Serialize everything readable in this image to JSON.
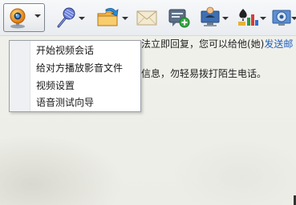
{
  "toolbar": {
    "buttons": [
      {
        "name": "video-chat",
        "icon": "webcam-icon",
        "has_dropdown": true
      },
      {
        "name": "voice-chat",
        "icon": "microphone-icon",
        "has_dropdown": true
      },
      {
        "name": "send-file",
        "icon": "folder-send-icon",
        "has_dropdown": true
      },
      {
        "name": "send-mail",
        "icon": "envelope-icon",
        "has_dropdown": false
      },
      {
        "name": "send-sms",
        "icon": "sms-add-icon",
        "has_dropdown": false
      },
      {
        "name": "remote-assist",
        "icon": "monitor-person-icon",
        "has_dropdown": true
      },
      {
        "name": "apps",
        "icon": "apps-icon",
        "has_dropdown": true
      },
      {
        "name": "settings",
        "icon": "settings-icon",
        "has_dropdown": true
      }
    ]
  },
  "chat": {
    "notice_text": "法立即回复，您可以给他(她)",
    "notice_link": "发送邮",
    "notice_text_2": "信息，勿轻易拨打陌生电话。"
  },
  "dropdown_menu": {
    "items": [
      {
        "label": "开始视频会话"
      },
      {
        "label": "给对方播放影音文件"
      },
      {
        "label": "视频设置"
      },
      {
        "label": "语音测试向导"
      }
    ]
  },
  "colors": {
    "link": "#1f5fbf",
    "menu_border": "#9aa0a8"
  }
}
